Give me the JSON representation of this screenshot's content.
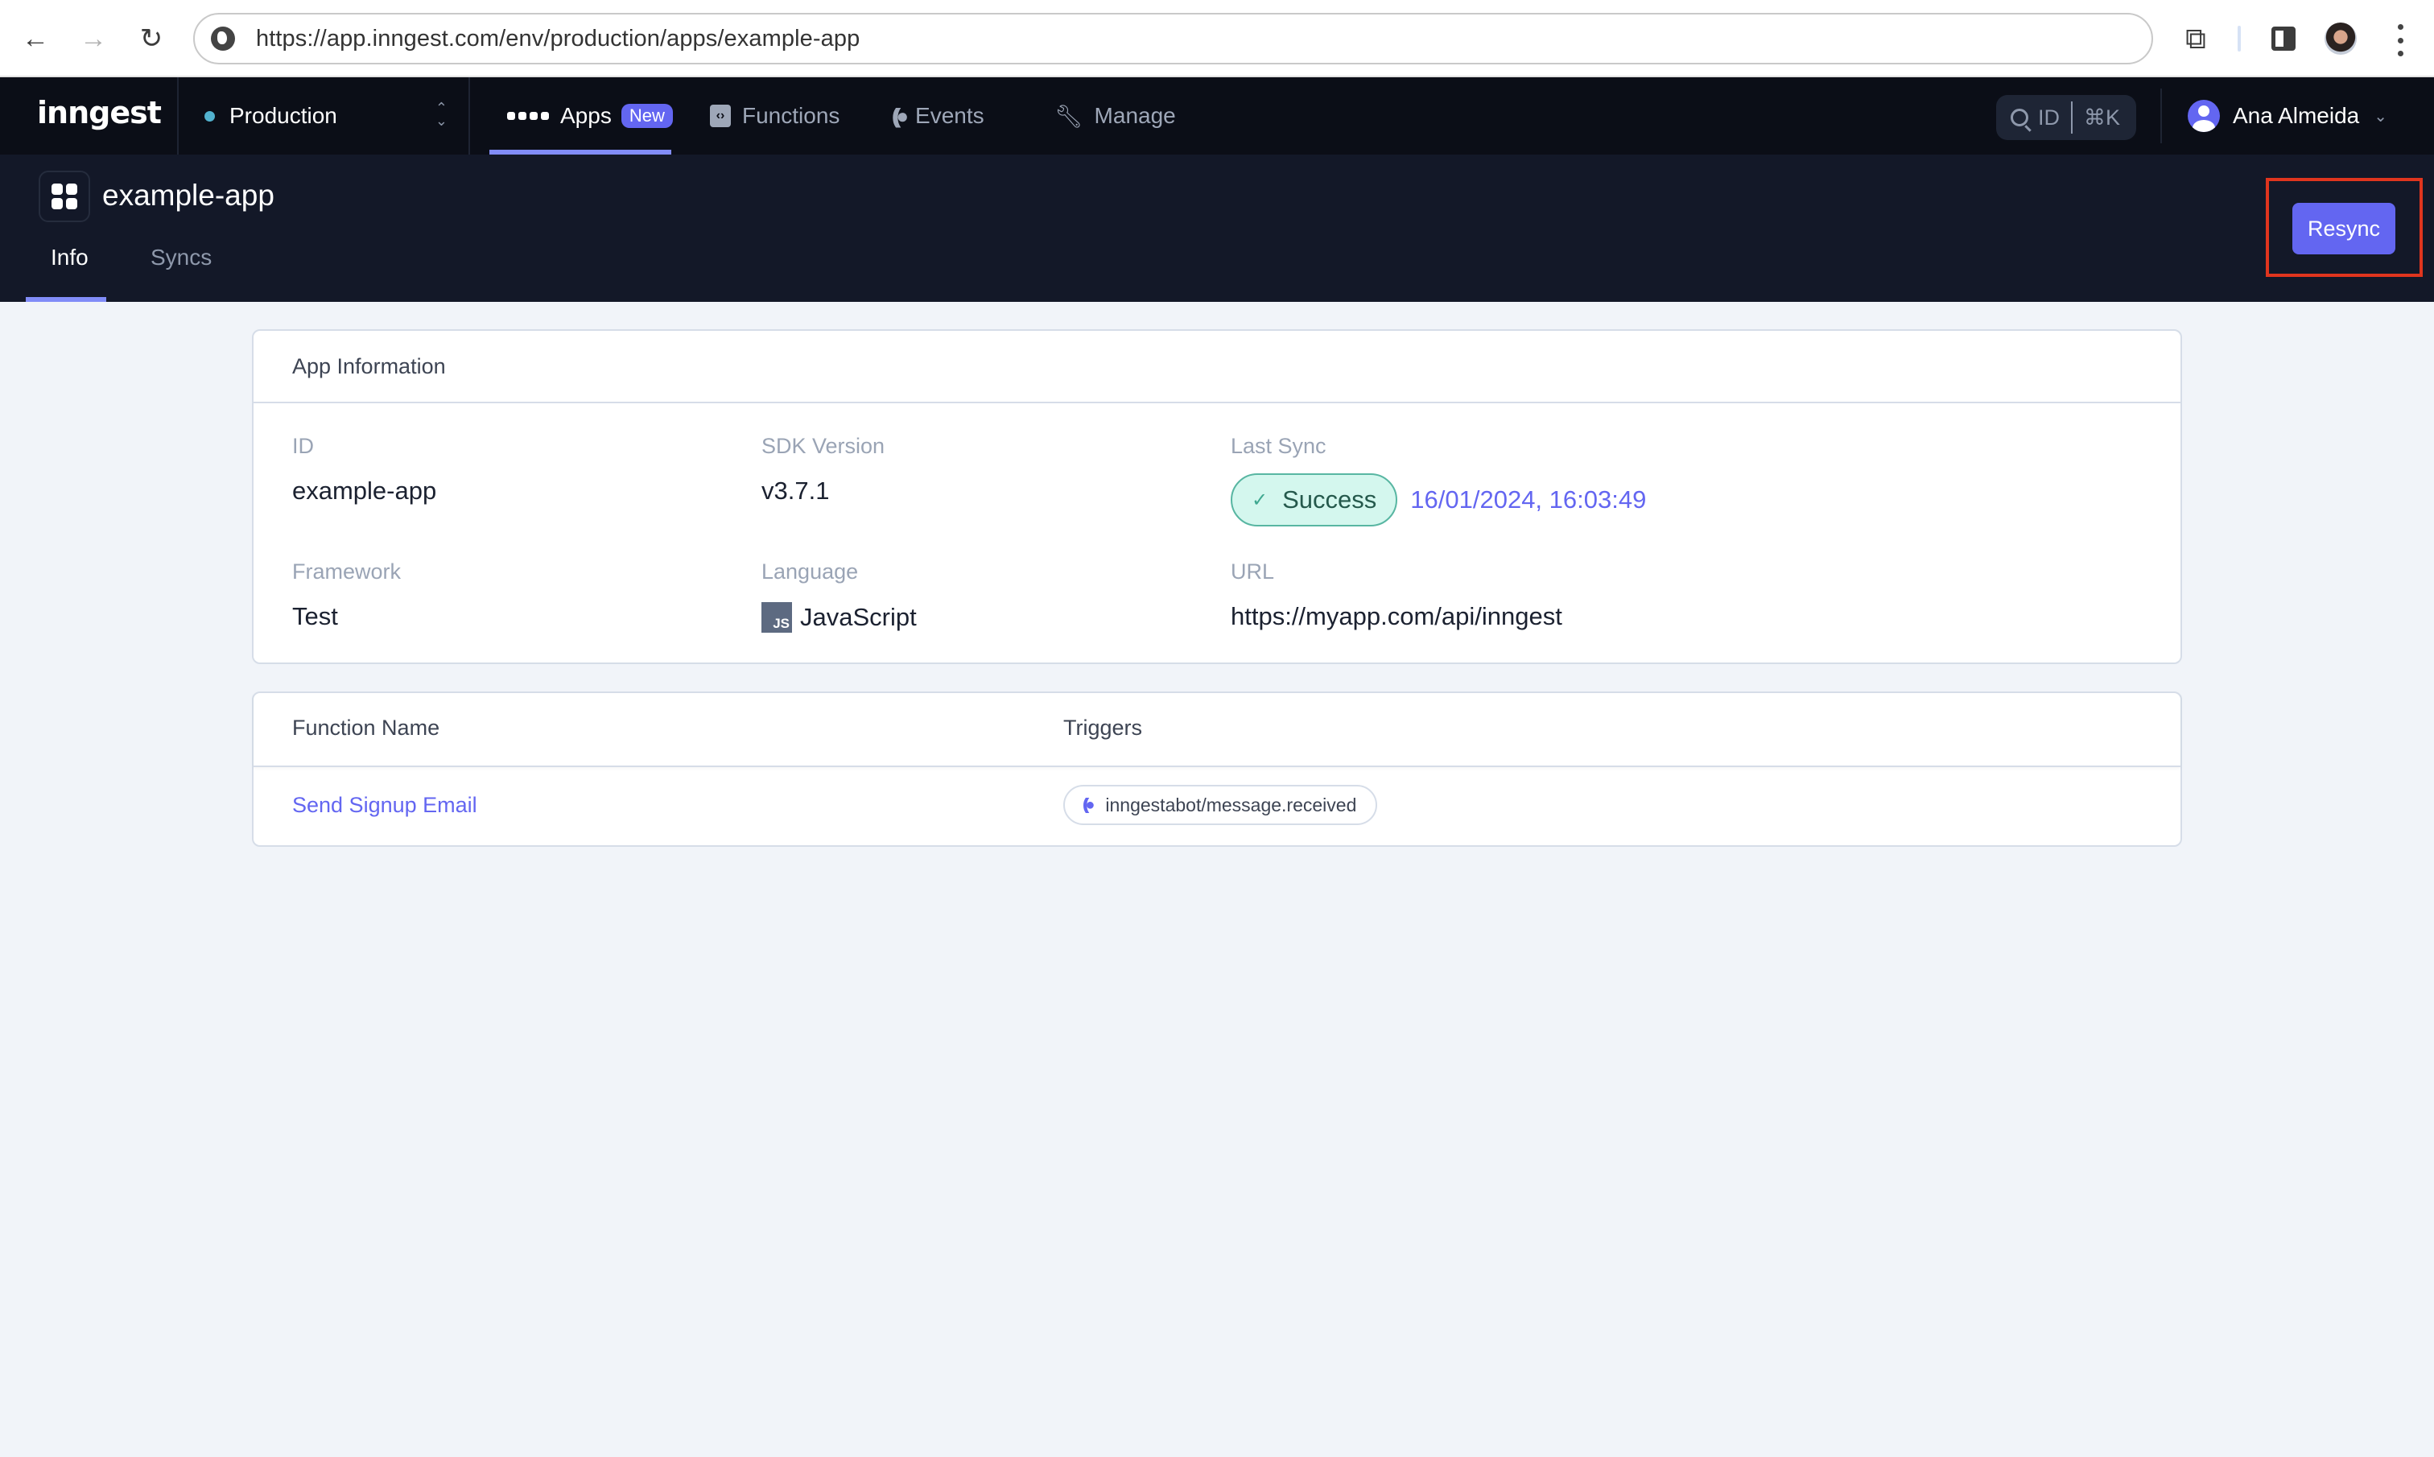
{
  "browser": {
    "url": "https://app.inngest.com/env/production/apps/example-app",
    "back_icon": "arrow-left-icon",
    "forward_icon": "arrow-right-icon",
    "reload_icon": "reload-icon"
  },
  "nav": {
    "logo": "inngest",
    "environment": "Production",
    "environment_color": "#52b2cf",
    "items": [
      {
        "label": "Apps",
        "badge": "New",
        "active": true,
        "icon": "apps-grid-icon"
      },
      {
        "label": "Functions",
        "icon": "function-code-icon"
      },
      {
        "label": "Events",
        "icon": "events-icon"
      },
      {
        "label": "Manage",
        "icon": "wrench-icon"
      }
    ],
    "search": {
      "label": "ID",
      "shortcut": "⌘K"
    },
    "user": {
      "name": "Ana Almeida"
    }
  },
  "app": {
    "title": "example-app",
    "tabs": [
      {
        "label": "Info",
        "active": true
      },
      {
        "label": "Syncs",
        "active": false
      }
    ],
    "resync_label": "Resync"
  },
  "app_information": {
    "heading": "App Information",
    "fields": {
      "id": {
        "label": "ID",
        "value": "example-app"
      },
      "sdk_version": {
        "label": "SDK Version",
        "value": "v3.7.1"
      },
      "last_sync": {
        "label": "Last Sync",
        "status": "Success",
        "time": "16/01/2024, 16:03:49"
      },
      "framework": {
        "label": "Framework",
        "value": "Test"
      },
      "language": {
        "label": "Language",
        "value": "JavaScript",
        "icon_text": "JS"
      },
      "url": {
        "label": "URL",
        "value": "https://myapp.com/api/inngest"
      }
    }
  },
  "functions_table": {
    "columns": [
      "Function Name",
      "Triggers"
    ],
    "rows": [
      {
        "name": "Send Signup Email",
        "trigger": "inngestabot/message.received"
      }
    ]
  },
  "colors": {
    "accent": "#6366f1",
    "nav_bg": "#0b0e17",
    "subheader_bg": "#131828",
    "page_bg": "#f1f4f9",
    "success_bg": "#d4f7ee",
    "highlight": "#e0351e"
  }
}
